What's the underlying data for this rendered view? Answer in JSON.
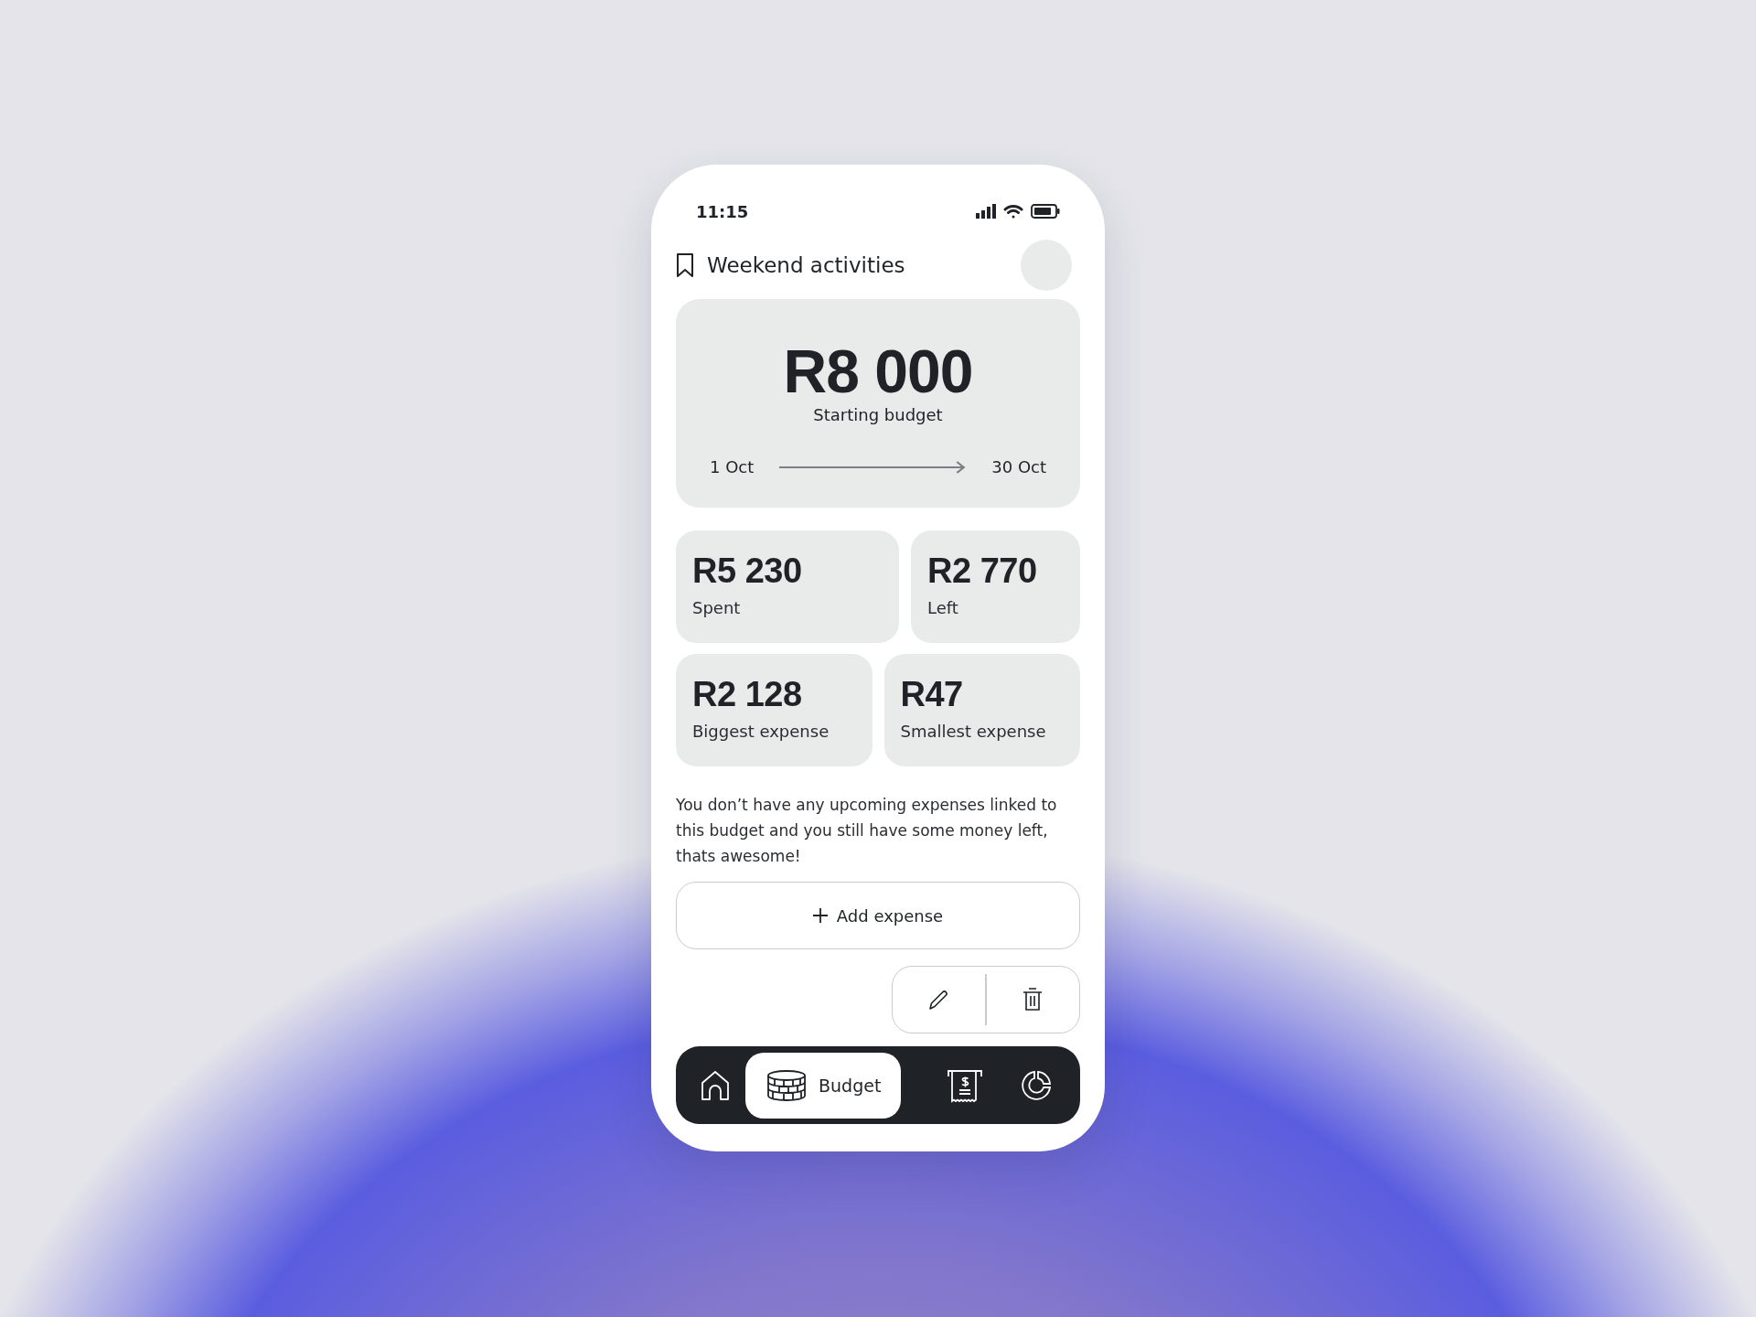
{
  "status_bar": {
    "time": "11:15"
  },
  "header": {
    "title": "Weekend activities"
  },
  "budget_card": {
    "amount": "R8 000",
    "label": "Starting budget",
    "start_date": "1 Oct",
    "end_date": "30 Oct"
  },
  "stats": [
    {
      "amount": "R5 230",
      "label": "Spent"
    },
    {
      "amount": "R2 770",
      "label": "Left"
    },
    {
      "amount": "R2 128",
      "label": "Biggest expense"
    },
    {
      "amount": "R47",
      "label": "Smallest expense"
    }
  ],
  "message": "You don’t have any upcoming expenses linked to this budget and you still have some money left, thats awesome!",
  "add_button": {
    "label": "Add expense"
  },
  "nav": [
    {
      "selected": false
    },
    {
      "label": "Budget",
      "selected": true
    },
    {
      "selected": false
    },
    {
      "selected": false
    }
  ]
}
